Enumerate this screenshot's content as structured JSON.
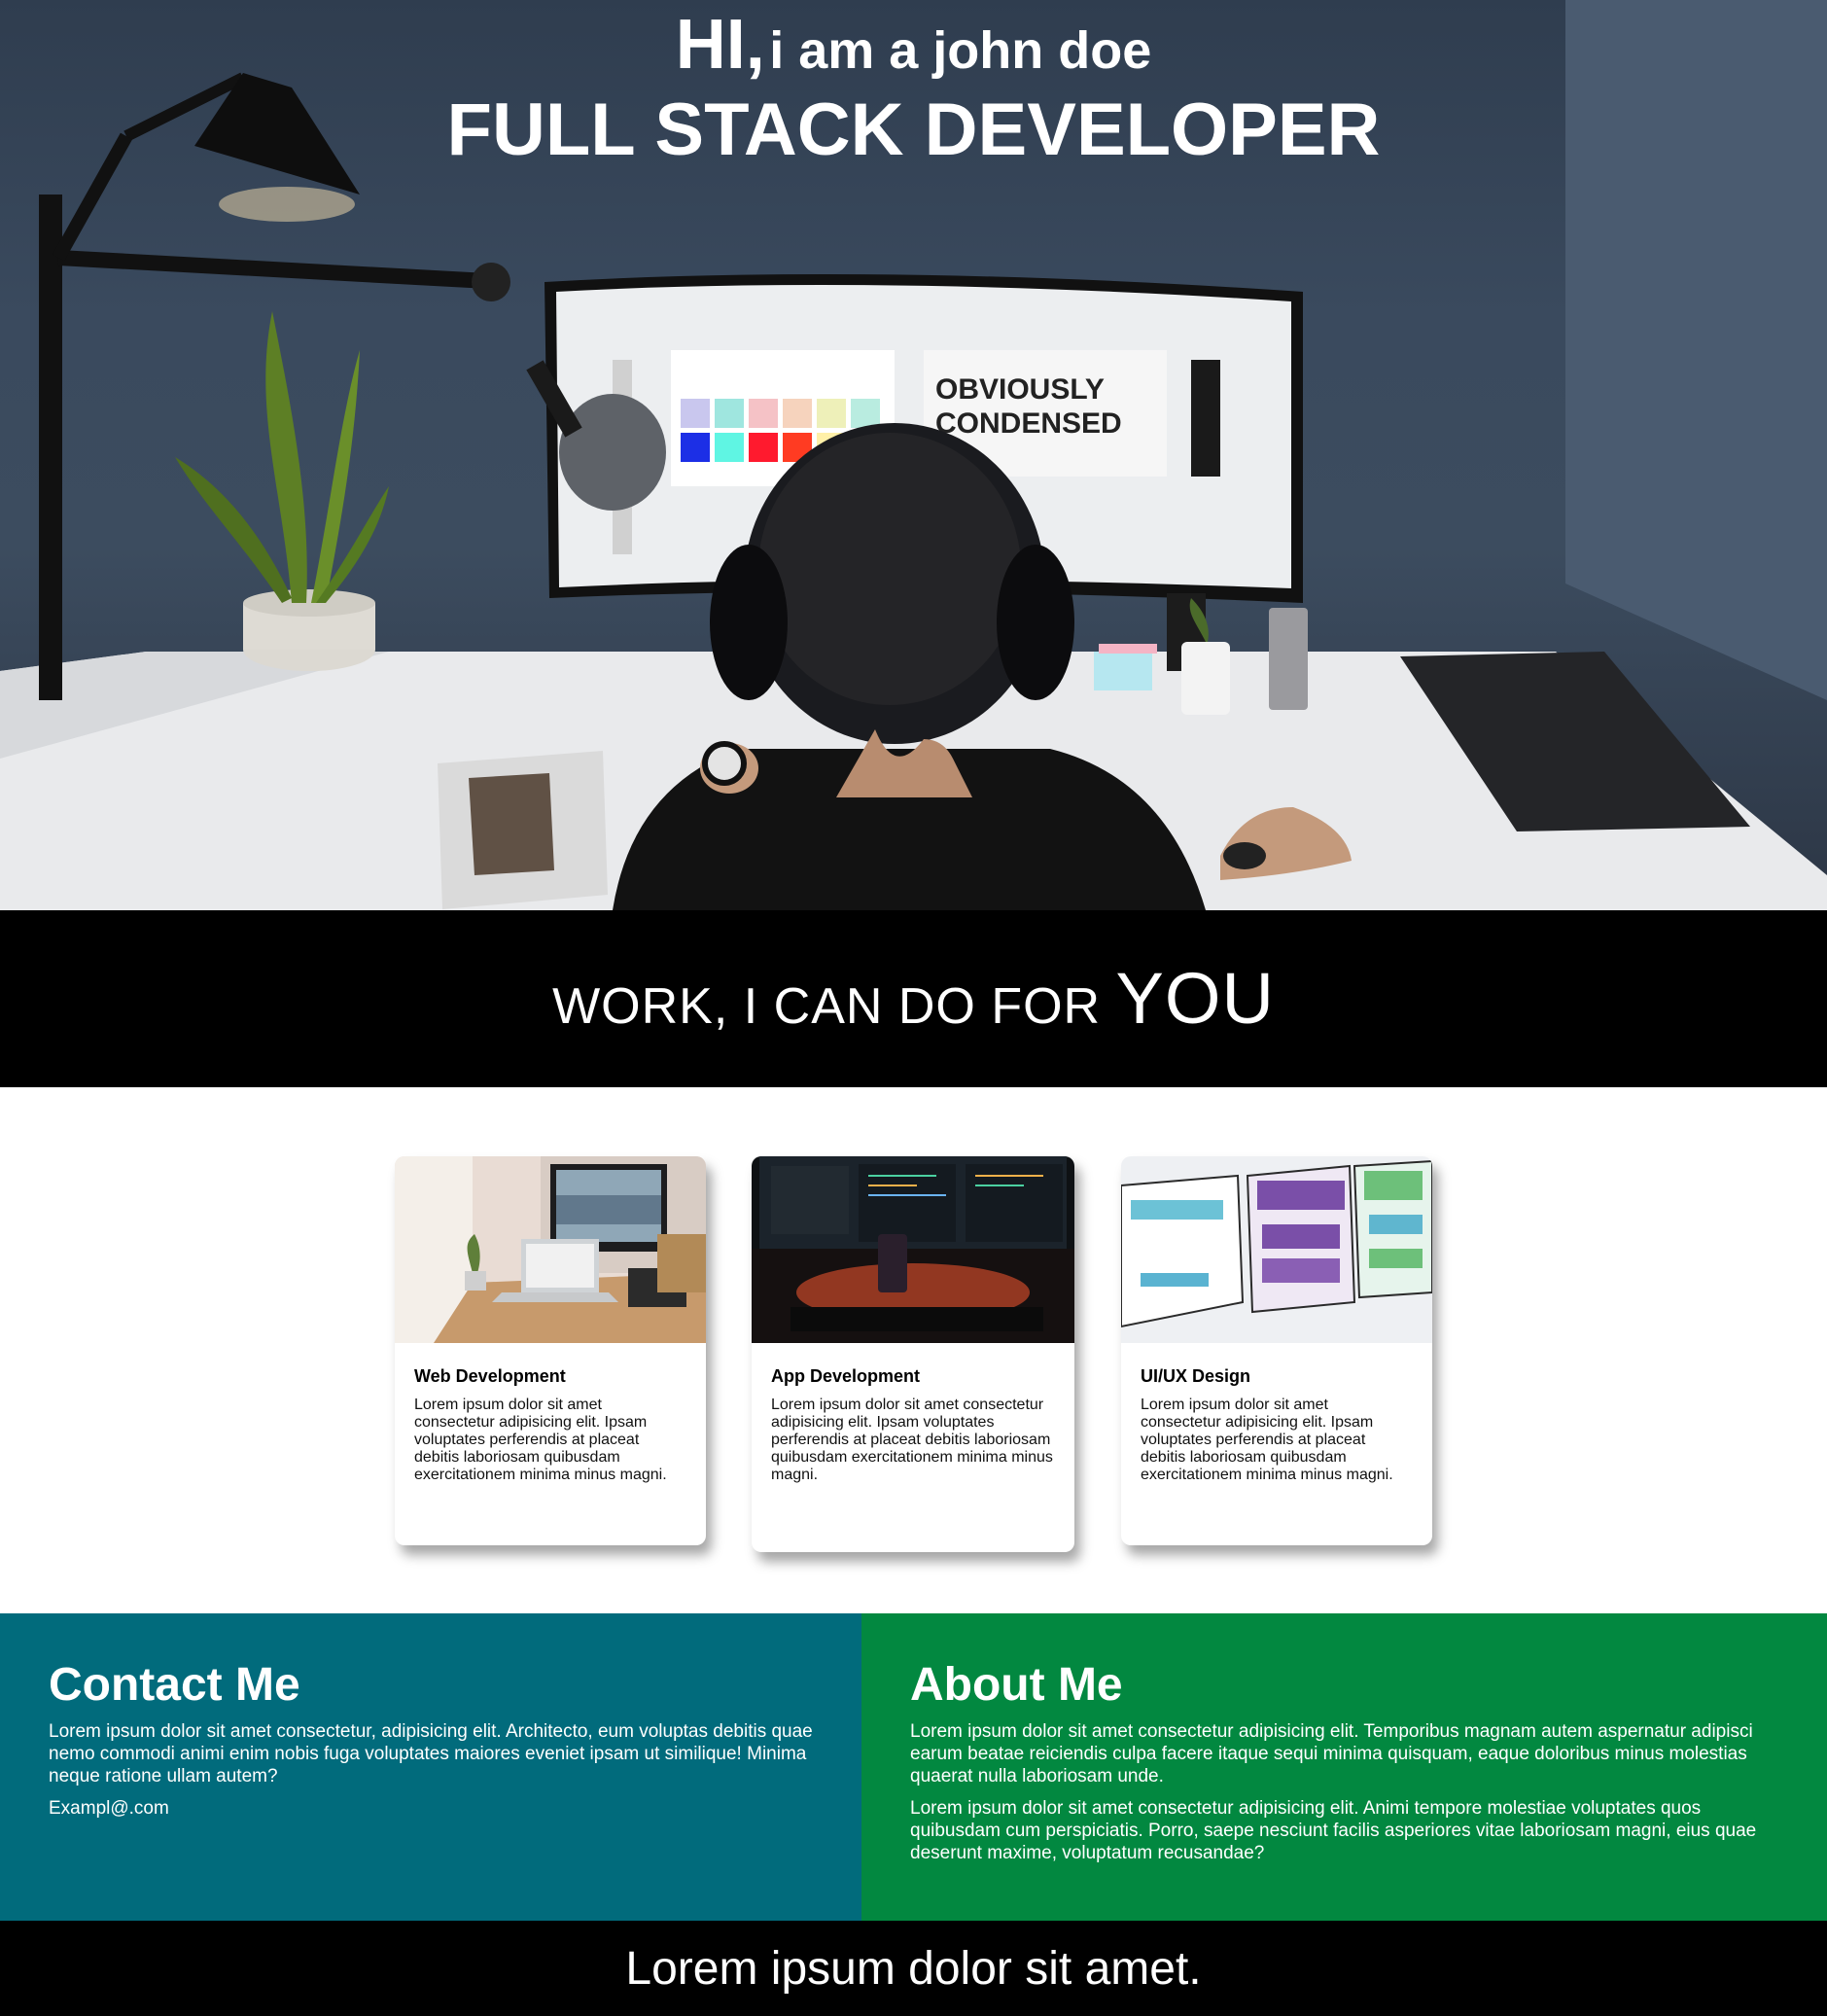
{
  "hero": {
    "hi": "HI,",
    "intro": "i am a john doe",
    "role": "FULL STACK DEVELOPER",
    "monitor_text_1": "OBVIOUSLY",
    "monitor_text_2": "CONDENSED"
  },
  "work": {
    "lead": "WORK, I CAN DO FOR",
    "emphasis": "YOU"
  },
  "cards": [
    {
      "title": "Web Development",
      "body": "Lorem ipsum dolor sit amet consectetur adipisicing elit. Ipsam voluptates perferendis at placeat debitis laboriosam quibusdam exercitationem minima minus magni."
    },
    {
      "title": "App Development",
      "body": "Lorem ipsum dolor sit amet consectetur adipisicing elit. Ipsam voluptates perferendis at placeat debitis laboriosam quibusdam exercitationem minima minus magni."
    },
    {
      "title": "UI/UX Design",
      "body": "Lorem ipsum dolor sit amet consectetur adipisicing elit. Ipsam voluptates perferendis at placeat debitis laboriosam quibusdam exercitationem minima minus magni."
    }
  ],
  "contact": {
    "title": "Contact Me",
    "body": "Lorem ipsum dolor sit amet consectetur, adipisicing elit. Architecto, eum voluptas debitis quae nemo commodi animi enim nobis fuga voluptates maiores eveniet ipsam ut similique! Minima neque ratione ullam autem?",
    "email": "Exampl@.com"
  },
  "about": {
    "title": "About Me",
    "para1": "Lorem ipsum dolor sit amet consectetur adipisicing elit. Temporibus magnam autem aspernatur adipisci earum beatae reiciendis culpa facere itaque sequi minima quisquam, eaque doloribus minus molestias quaerat nulla laboriosam unde.",
    "para2": "Lorem ipsum dolor sit amet consectetur adipisicing elit. Animi tempore molestiae voluptates quos quibusdam cum perspiciatis. Porro, saepe nesciunt facilis asperiores vitae laboriosam magni, eius quae deserunt maxime, voluptatum recusandae?"
  },
  "footer": {
    "text": "Lorem ipsum dolor sit amet."
  },
  "colors": {
    "contact_bg": "#016b7c",
    "about_bg": "#028840",
    "band_bg": "#000000"
  }
}
